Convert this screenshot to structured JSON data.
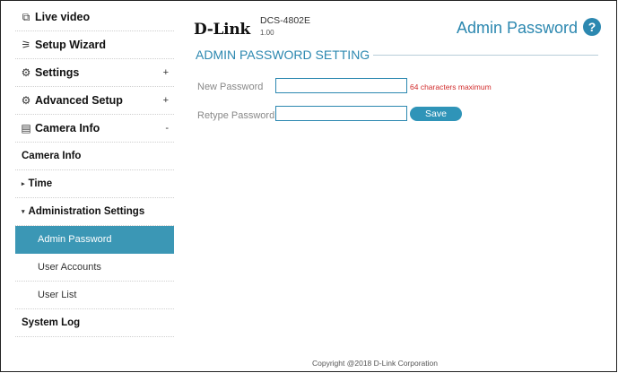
{
  "sidebar": {
    "items": [
      {
        "label": "Live video",
        "icon": "live-video-icon",
        "glyph": "⧉"
      },
      {
        "label": "Setup Wizard",
        "icon": "wizard-icon",
        "glyph": "⚞"
      },
      {
        "label": "Settings",
        "icon": "settings-icon",
        "glyph": "⚙",
        "sign": "+"
      },
      {
        "label": "Advanced Setup",
        "icon": "advanced-settings-icon",
        "glyph": "⚙",
        "sign": "+"
      },
      {
        "label": "Camera Info",
        "icon": "document-icon",
        "glyph": "▤",
        "sign": "-"
      }
    ],
    "sub": {
      "camera_info": "Camera Info",
      "time": "Time",
      "administration": "Administration Settings",
      "admin_password": "Admin Password",
      "user_accounts": "User Accounts",
      "user_list": "User List",
      "system_log": "System Log"
    }
  },
  "header": {
    "brand": "D-Link",
    "model": "DCS-4802E",
    "firmware": "1.00",
    "page_title": "Admin Password",
    "help_glyph": "?"
  },
  "form": {
    "section_title": "ADMIN PASSWORD SETTING",
    "new_password_label": "New Password",
    "retype_password_label": "Retype Password",
    "new_password_value": "",
    "retype_password_value": "",
    "hint": "64 characters maximum",
    "save_label": "Save"
  },
  "footer": {
    "copyright": "Copyright @2018 D-Link Corporation"
  },
  "colors": {
    "accent": "#2c88b0",
    "active_bg": "#3b97b5",
    "hint": "#d12c2c"
  }
}
